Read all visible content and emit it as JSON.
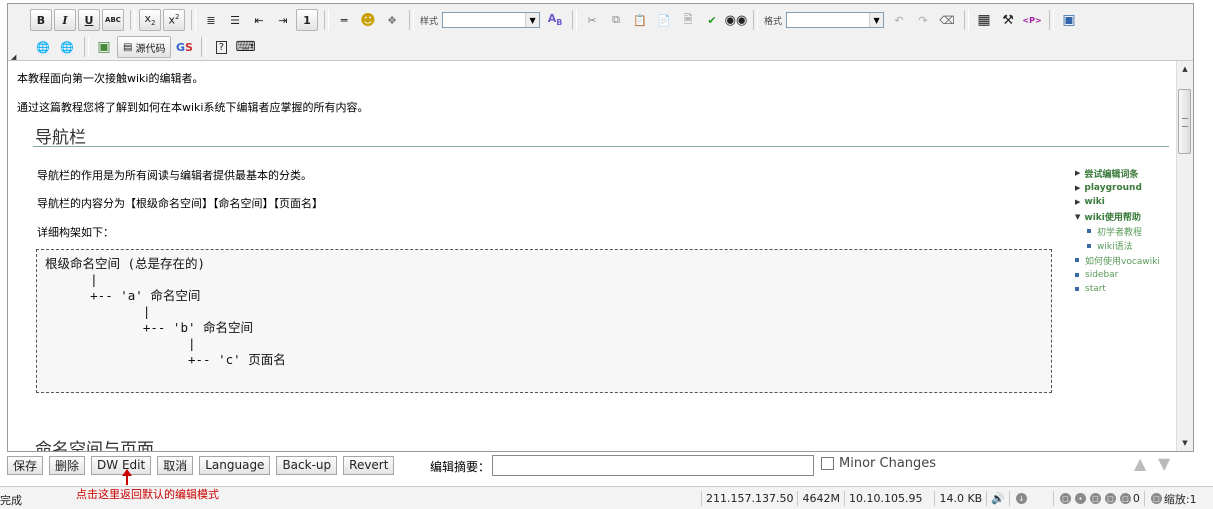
{
  "toolbar": {
    "row1": [
      {
        "name": "bold-button",
        "glyph": "B"
      },
      {
        "name": "italic-button",
        "glyph": "I"
      },
      {
        "name": "underline-button",
        "glyph": "U"
      },
      {
        "name": "strikethrough-button",
        "glyph": "ABC"
      },
      {
        "name": "subscript-button",
        "glyph": "x₂"
      },
      {
        "name": "superscript-button",
        "glyph": "x²"
      },
      {
        "name": "ordered-list-button",
        "glyph": "≡"
      },
      {
        "name": "unordered-list-button",
        "glyph": "☰"
      },
      {
        "name": "outdent-button",
        "glyph": "⇤"
      },
      {
        "name": "indent-button",
        "glyph": "⇥"
      },
      {
        "name": "heading-button",
        "glyph": "1"
      },
      {
        "name": "horizontal-rule-button",
        "glyph": "―"
      },
      {
        "name": "smiley-button",
        "glyph": "☺"
      },
      {
        "name": "special-char-button",
        "glyph": "❖"
      }
    ],
    "style_label": "样式",
    "format_label": "格式",
    "row2_source_label": "源代码"
  },
  "content": {
    "intro1": "本教程面向第一次接触wiki的编辑者。",
    "intro2": "通过这篇教程您将了解到如何在本wiki系统下编辑者应掌握的所有内容。",
    "heading1": "导航栏",
    "para1": "导航栏的作用是为所有阅读与编辑者提供最基本的分类。",
    "para2": "导航栏的内容分为【根级命名空间】【命名空间】【页面名】",
    "para3": "详细构架如下：",
    "code": "根级命名空间 (总是存在的)\n      |\n      +-- 'a' 命名空间\n             |\n             +-- 'b' 命名空间\n                   |\n                   +-- 'c' 页面名",
    "heading2": "命名空间与页面"
  },
  "toc": {
    "items": [
      {
        "label": "尝试编辑词条",
        "type": "closed"
      },
      {
        "label": "playground",
        "type": "closed"
      },
      {
        "label": "wiki",
        "type": "closed"
      },
      {
        "label": "wiki使用帮助",
        "type": "open"
      },
      {
        "label": "初学者教程",
        "type": "sub"
      },
      {
        "label": "wiki语法",
        "type": "sub"
      },
      {
        "label": "如何使用vocawiki",
        "type": "leaf"
      },
      {
        "label": "sidebar",
        "type": "leaf"
      },
      {
        "label": "start",
        "type": "leaf"
      }
    ]
  },
  "buttons": {
    "save": "保存",
    "delete": "删除",
    "dw_edit": "DW Edit",
    "cancel": "取消",
    "language": "Language",
    "backup": "Back-up",
    "revert": "Revert"
  },
  "summary": {
    "label": "编辑摘要：",
    "value": ""
  },
  "minor_changes": "Minor Changes",
  "annotation": "点击这里返回默认的编辑模式",
  "status": {
    "left": "完成",
    "ip1": "211.157.137.50",
    "mem": "4642M",
    "ip2": "10.10.105.95",
    "size": "14.0 KB",
    "count": "0",
    "zoom": "缩放:1"
  }
}
